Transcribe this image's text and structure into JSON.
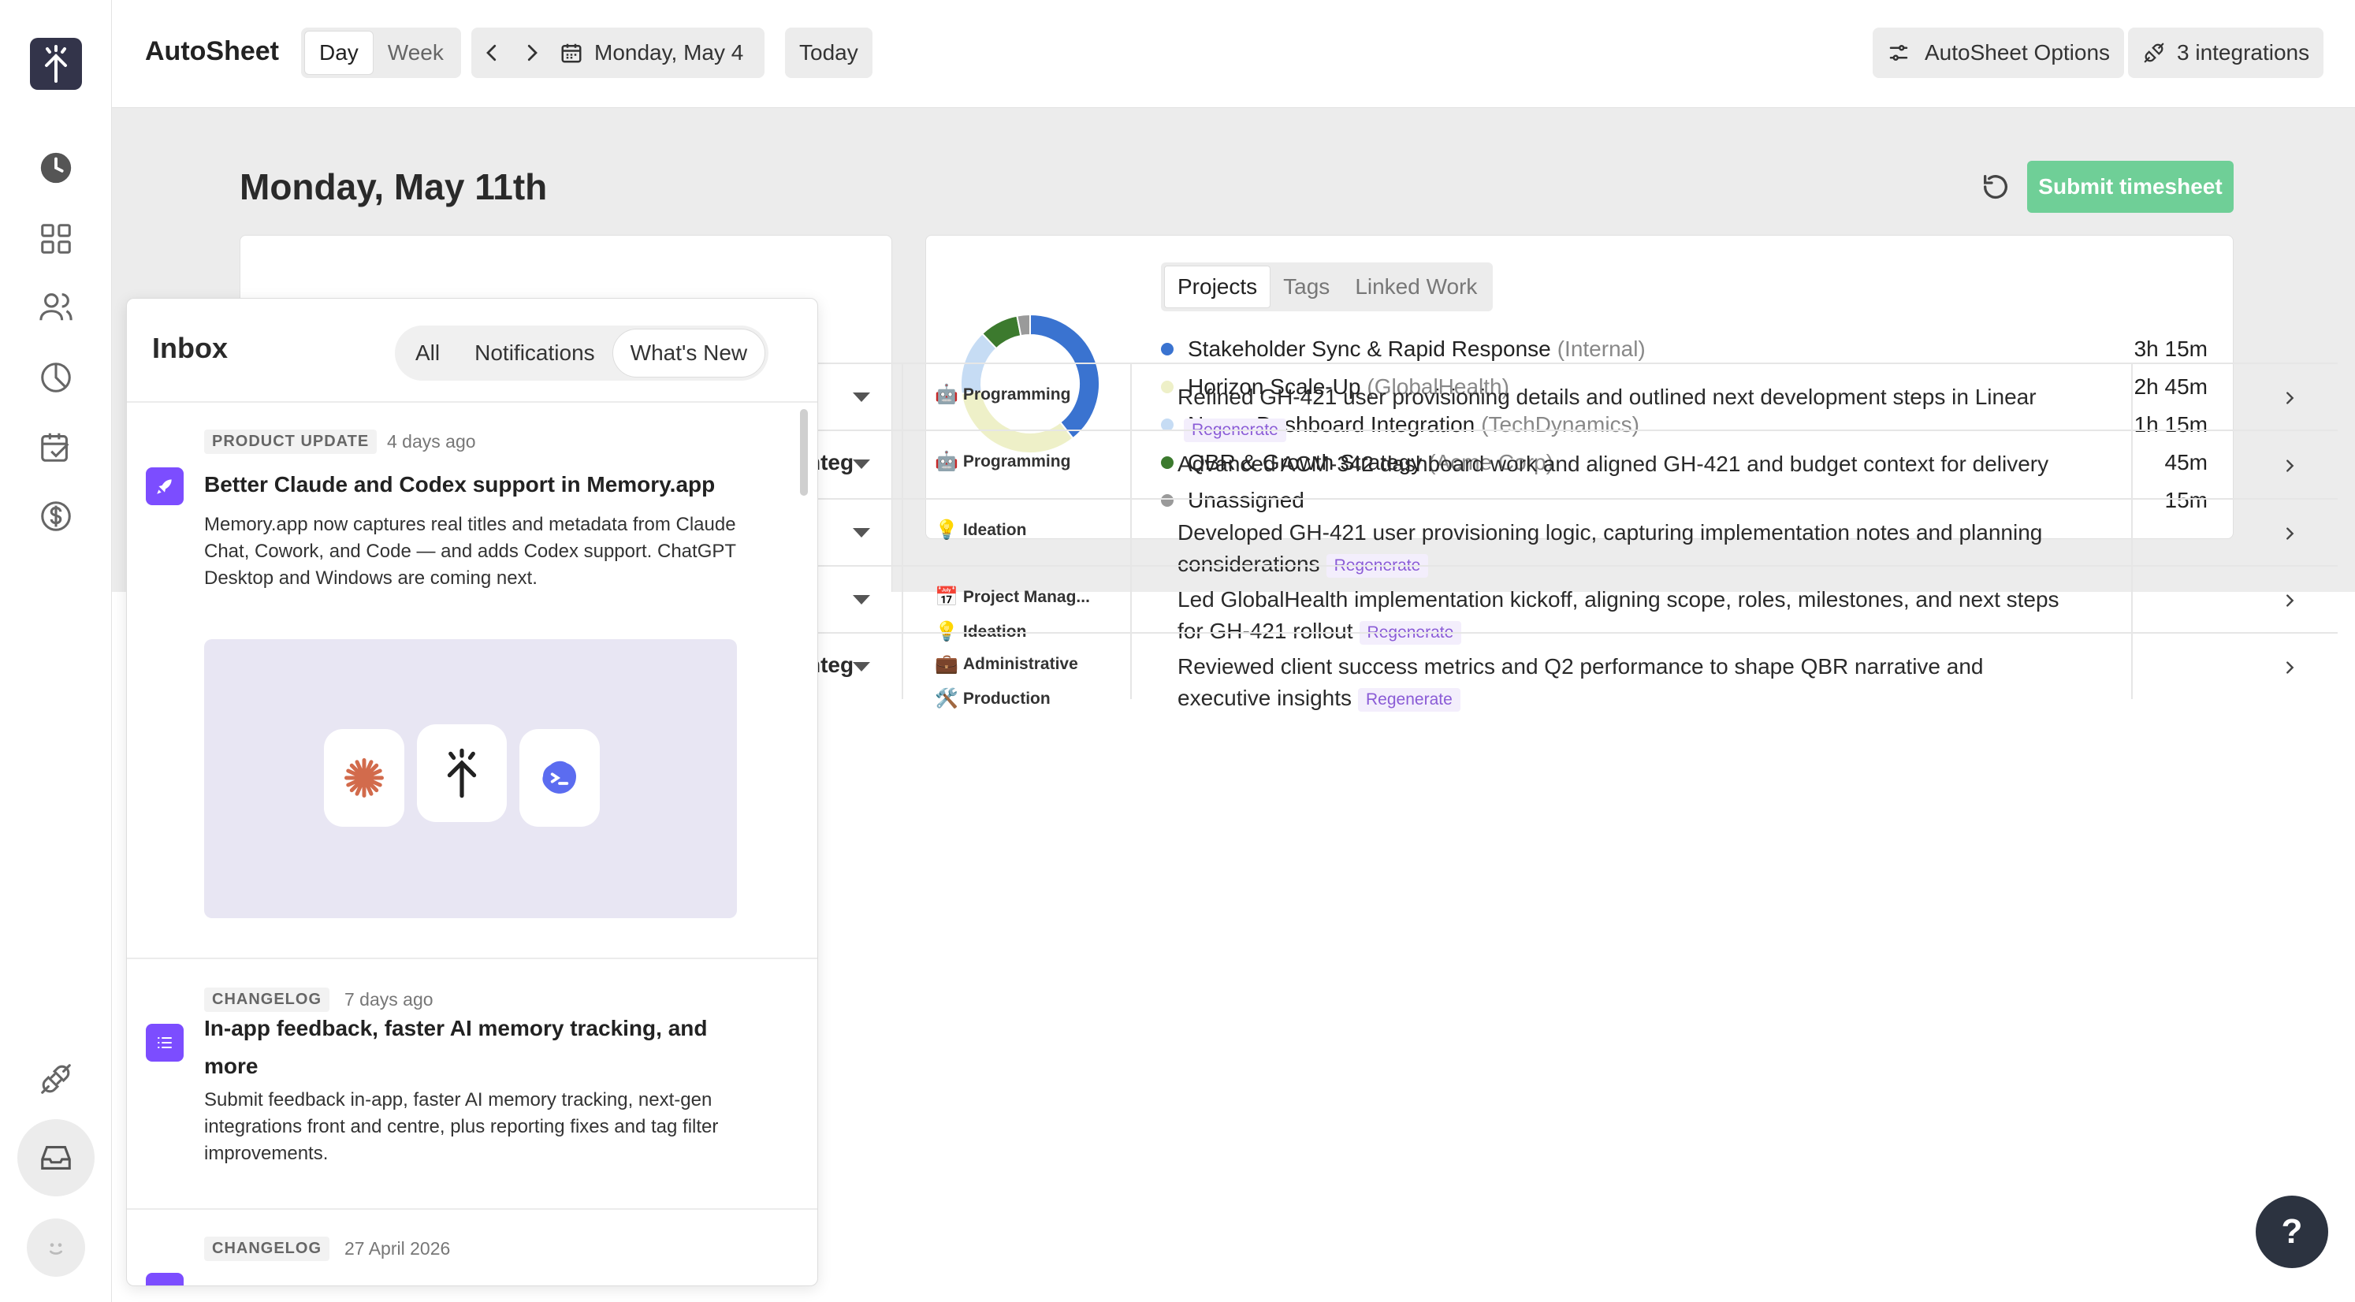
{
  "app": {
    "title": "AutoSheet"
  },
  "header": {
    "view_toggle": [
      {
        "label": "Day",
        "selected": true
      },
      {
        "label": "Week",
        "selected": false
      }
    ],
    "date_label": "Monday, May 4",
    "today_label": "Today",
    "options_label": "AutoSheet Options",
    "integrations_label": "3 integrations"
  },
  "sidebar": {
    "icons": [
      "clock-icon",
      "grid-icon",
      "users-icon",
      "pie-chart-icon",
      "calendar-check-icon",
      "dollar-icon",
      "plug-icon",
      "inbox-icon",
      "smiley-icon"
    ],
    "active": "inbox-icon"
  },
  "day": {
    "title": "Monday, May 11th",
    "submit_label": "Submit timesheet"
  },
  "summary": {
    "tabs": [
      {
        "label": "Projects",
        "selected": true
      },
      {
        "label": "Tags"
      },
      {
        "label": "Linked Work"
      }
    ],
    "rows": [
      {
        "name": "Stakeholder Sync & Rapid Response",
        "client": "(Internal)",
        "duration": "3h 15m",
        "minutes": 195,
        "color": "#3a73d0"
      },
      {
        "name": "Horizon Scale-Up",
        "client": "(GlobalHealth)",
        "duration": "2h 45m",
        "minutes": 165,
        "color": "#eef0c8"
      },
      {
        "name": "Nexus Dashboard Integration",
        "client": "(TechDynamics)",
        "duration": "1h 15m",
        "minutes": 75,
        "color": "#c6dcf4"
      },
      {
        "name": "QBR & Growth Strategy",
        "client": "(Acme Corp)",
        "duration": "45m",
        "minutes": 45,
        "color": "#3c7a2e"
      },
      {
        "name": "Unassigned",
        "client": "",
        "duration": "15m",
        "minutes": 15,
        "color": "#9a9a9a"
      }
    ]
  },
  "entries": [
    {
      "cut": "",
      "tags": [
        {
          "emoji": "🤖",
          "label": "Programming"
        }
      ],
      "desc": "Refined GH-421 user provisioning details and outlined next development steps in Linear",
      "regenerate": "Regenerate"
    },
    {
      "cut": "nteg",
      "tags": [
        {
          "emoji": "🤖",
          "label": "Programming"
        }
      ],
      "desc": "Advanced ACM-342 dashboard work and aligned GH-421 and budget context for delivery",
      "regenerate": ""
    },
    {
      "cut": "",
      "tags": [
        {
          "emoji": "💡",
          "label": "Ideation"
        }
      ],
      "desc": "Developed GH-421 user provisioning logic, capturing implementation notes and planning considerations",
      "regenerate": "Regenerate"
    },
    {
      "cut": "",
      "tags": [
        {
          "emoji": "📅",
          "label": "Project Manag..."
        },
        {
          "emoji": "💡",
          "label": "Ideation"
        }
      ],
      "desc": "Led GlobalHealth implementation kickoff, aligning scope, roles, milestones, and next steps for GH-421 rollout",
      "regenerate": "Regenerate"
    },
    {
      "cut": "nteg",
      "tags": [
        {
          "emoji": "💼",
          "label": "Administrative"
        },
        {
          "emoji": "🛠️",
          "label": "Production"
        }
      ],
      "desc": "Reviewed client success metrics and Q2 performance to shape QBR narrative and executive insights",
      "regenerate": "Regenerate"
    }
  ],
  "inbox": {
    "title": "Inbox",
    "filters": [
      {
        "label": "All"
      },
      {
        "label": "Notifications"
      },
      {
        "label": "What's New",
        "selected": true
      }
    ],
    "items": [
      {
        "kind": "PRODUCT UPDATE",
        "ago": "4 days ago",
        "title": "Better Claude and Codex support in Memory.app",
        "body": "Memory.app now captures real titles and metadata from Claude Chat, Cowork, and Code — and adds Codex support. ChatGPT Desktop and Windows are coming next."
      },
      {
        "kind": "CHANGELOG",
        "ago": "7 days ago",
        "title": "In-app feedback, faster AI memory tracking, and more",
        "body": "Submit feedback in-app, faster AI memory tracking, next-gen integrations front and centre, plus reporting fixes and tag filter improvements."
      },
      {
        "kind": "CHANGELOG",
        "ago": "27 April 2026",
        "title": "",
        "body": ""
      }
    ]
  },
  "help_label": "?"
}
